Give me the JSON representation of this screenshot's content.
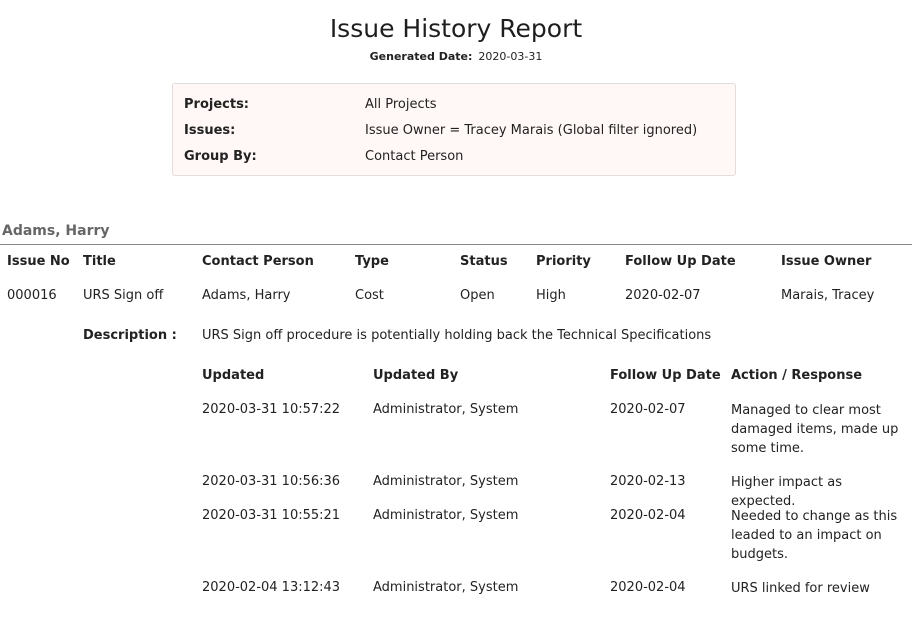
{
  "report": {
    "title": "Issue History Report",
    "generated_label": "Generated Date:",
    "generated_value": "2020-03-31"
  },
  "filters": [
    {
      "label": "Projects:",
      "value": "All Projects"
    },
    {
      "label": "Issues:",
      "value": "Issue Owner = Tracey Marais (Global filter ignored)"
    },
    {
      "label": "Group By:",
      "value": "Contact Person"
    }
  ],
  "group": {
    "name": "Adams, Harry"
  },
  "issue_columns": [
    "Issue No",
    "Title",
    "Contact Person",
    "Type",
    "Status",
    "Priority",
    "Follow Up Date",
    "Issue Owner"
  ],
  "issue": {
    "issue_no": "000016",
    "title": "URS Sign off",
    "contact_person": "Adams, Harry",
    "type": "Cost",
    "status": "Open",
    "priority": "High",
    "follow_up_date": "2020-02-07",
    "issue_owner": "Marais, Tracey",
    "description_label": "Description :",
    "description": "URS Sign off procedure is potentially holding back the Technical Specifications"
  },
  "history_columns": [
    "Updated",
    "Updated By",
    "Follow Up Date",
    "Action / Response"
  ],
  "history": [
    {
      "updated": "2020-03-31 10:57:22",
      "updated_by": "Administrator, System",
      "follow_up": "2020-02-07",
      "action": "Managed to clear most damaged items, made up some time."
    },
    {
      "updated": "2020-03-31 10:56:36",
      "updated_by": "Administrator, System",
      "follow_up": "2020-02-13",
      "action": "Higher impact as expected."
    },
    {
      "updated": "2020-03-31 10:55:21",
      "updated_by": "Administrator, System",
      "follow_up": "2020-02-04",
      "action": "Needed to change as this leaded to an impact on budgets."
    },
    {
      "updated": "2020-02-04 13:12:43",
      "updated_by": "Administrator, System",
      "follow_up": "2020-02-04",
      "action": "URS linked for review"
    }
  ]
}
